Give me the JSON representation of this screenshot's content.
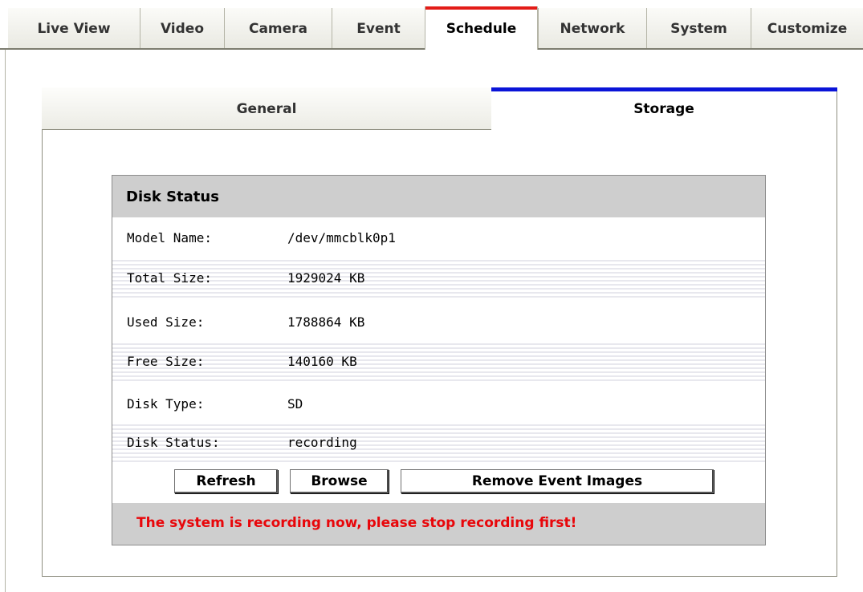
{
  "top_tabs": [
    {
      "label": "Live View",
      "active": false
    },
    {
      "label": "Video",
      "active": false
    },
    {
      "label": "Camera",
      "active": false
    },
    {
      "label": "Event",
      "active": false
    },
    {
      "label": "Schedule",
      "active": true
    },
    {
      "label": "Network",
      "active": false
    },
    {
      "label": "System",
      "active": false
    },
    {
      "label": "Customize",
      "active": false
    }
  ],
  "sub_tabs": [
    {
      "label": "General",
      "active": false
    },
    {
      "label": "Storage",
      "active": true
    }
  ],
  "disk_status": {
    "title": "Disk Status",
    "rows": [
      {
        "key": "Model Name:",
        "value": "/dev/mmcblk0p1"
      },
      {
        "key": "Total Size:",
        "value": "1929024 KB"
      },
      {
        "key": "Used Size:",
        "value": "1788864 KB"
      },
      {
        "key": "Free Size:",
        "value": "140160 KB"
      },
      {
        "key": "Disk Type:",
        "value": "SD"
      },
      {
        "key": "Disk Status:",
        "value": "recording"
      }
    ]
  },
  "buttons": {
    "refresh": "Refresh",
    "browse": "Browse",
    "remove_event_images": "Remove Event Images"
  },
  "warning": "The system is recording now, please stop recording first!",
  "colors": {
    "active_top_tab_accent": "#e31c17",
    "active_sub_tab_accent": "#0a14d8",
    "warning_text": "#e8060a",
    "header_gray": "#cecece"
  }
}
